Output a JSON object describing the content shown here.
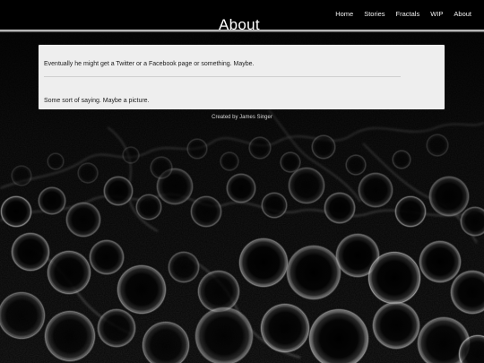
{
  "header": {
    "title": "About",
    "nav": [
      {
        "label": "Home"
      },
      {
        "label": "Stories"
      },
      {
        "label": "Fractals"
      },
      {
        "label": "WIP"
      },
      {
        "label": "About"
      }
    ]
  },
  "content": {
    "paragraph_1": "Eventually he might get a Twitter or a Facebook page or something. Maybe.",
    "paragraph_2": "Some sort of saying. Maybe a picture."
  },
  "footer": {
    "credit": "Created by James Singer"
  },
  "colors": {
    "background": "#050505",
    "header": "#000000",
    "card": "#eeeeee",
    "text": "#1c1c1c",
    "nav_text": "#f2f2f2"
  }
}
